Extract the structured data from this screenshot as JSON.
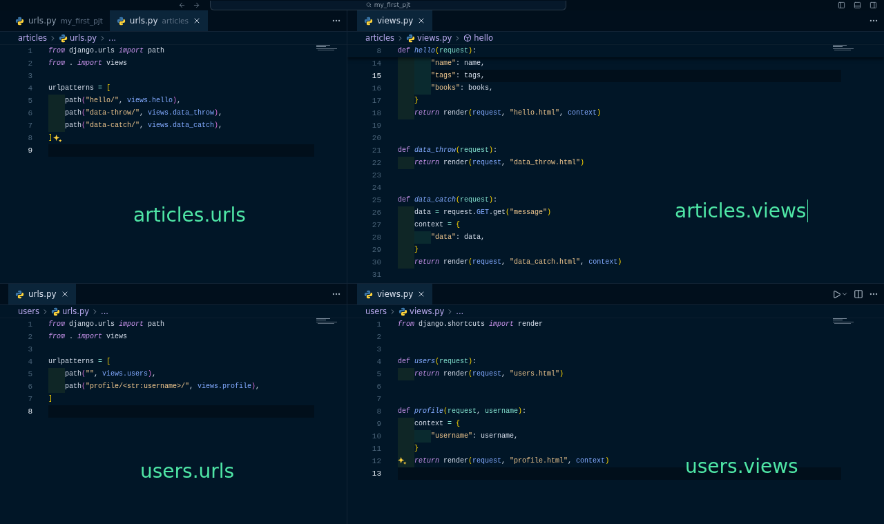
{
  "titlebar": {
    "search": "my_first_pjt"
  },
  "panes": [
    {
      "tabs": [
        {
          "label": "urls.py",
          "description": "my_first_pjt",
          "selected": false
        },
        {
          "label": "urls.py",
          "description": "articles",
          "selected": true
        }
      ],
      "actions": [
        {
          "kind": "more"
        }
      ],
      "breadcrumb": [
        {
          "kind": "folder",
          "text": "articles"
        },
        {
          "kind": "file",
          "text": "urls.py"
        },
        {
          "kind": "ellipsis",
          "text": "..."
        }
      ],
      "lines": [
        {
          "n": "1",
          "current": false,
          "tokens": [
            {
              "kind": "kw",
              "text": "from"
            },
            {
              "kind": "txt",
              "text": " django.urls "
            },
            {
              "kind": "kw",
              "text": "import"
            },
            {
              "kind": "txt",
              "text": " path"
            }
          ]
        },
        {
          "n": "2",
          "current": false,
          "tokens": [
            {
              "kind": "kw",
              "text": "from"
            },
            {
              "kind": "txt",
              "text": " . "
            },
            {
              "kind": "kw",
              "text": "import"
            },
            {
              "kind": "txt",
              "text": " views"
            }
          ]
        },
        {
          "n": "3",
          "current": false
        },
        {
          "n": "4",
          "current": false,
          "tokens": [
            {
              "kind": "txt",
              "text": "urlpatterns "
            },
            {
              "kind": "op",
              "text": "="
            },
            {
              "kind": "b1",
              "text": " ["
            }
          ]
        },
        {
          "n": "5",
          "current": false,
          "tokens": [
            {
              "kind": "indent"
            },
            {
              "kind": "txt",
              "text": "path"
            },
            {
              "kind": "b2",
              "text": "("
            },
            {
              "kind": "str",
              "text": "\"hello/\""
            },
            {
              "kind": "txt",
              "text": ", "
            },
            {
              "kind": "ref",
              "text": "views.hello"
            },
            {
              "kind": "b2",
              "text": ")"
            },
            {
              "kind": "txt",
              "text": ","
            }
          ]
        },
        {
          "n": "6",
          "current": false,
          "tokens": [
            {
              "kind": "indent"
            },
            {
              "kind": "txt",
              "text": "path"
            },
            {
              "kind": "b2",
              "text": "("
            },
            {
              "kind": "str",
              "text": "\"data-throw/\""
            },
            {
              "kind": "txt",
              "text": ", "
            },
            {
              "kind": "ref",
              "text": "views.data_throw"
            },
            {
              "kind": "b2",
              "text": ")"
            },
            {
              "kind": "txt",
              "text": ","
            }
          ]
        },
        {
          "n": "7",
          "current": false,
          "tokens": [
            {
              "kind": "indent"
            },
            {
              "kind": "txt",
              "text": "path"
            },
            {
              "kind": "b2",
              "text": "("
            },
            {
              "kind": "str",
              "text": "\"data-catch/\""
            },
            {
              "kind": "txt",
              "text": ", "
            },
            {
              "kind": "ref",
              "text": "views.data_catch"
            },
            {
              "kind": "b2",
              "text": ")"
            },
            {
              "kind": "txt",
              "text": ","
            }
          ]
        },
        {
          "n": "8",
          "current": false,
          "sparkle": true,
          "tokens": [
            {
              "kind": "b1",
              "text": "]"
            }
          ]
        },
        {
          "n": "9",
          "current": true
        }
      ],
      "annotation": {
        "text": "articles.urls",
        "cursor": false
      }
    },
    {
      "tabs": [
        {
          "label": "views.py",
          "selected": true
        }
      ],
      "actions": [
        {
          "kind": "more"
        }
      ],
      "breadcrumb": [
        {
          "kind": "folder",
          "text": "articles"
        },
        {
          "kind": "file",
          "text": "views.py"
        },
        {
          "kind": "symbol",
          "text": "hello"
        }
      ],
      "sticky": {
        "n": "8",
        "current": false,
        "tokens": [
          {
            "kind": "def",
            "text": "def "
          },
          {
            "kind": "fn",
            "text": "hello"
          },
          {
            "kind": "b1",
            "text": "("
          },
          {
            "kind": "param",
            "text": "request"
          },
          {
            "kind": "b1",
            "text": ")"
          },
          {
            "kind": "txt",
            "text": ":"
          }
        ]
      },
      "lines": [
        {
          "n": "14",
          "current": false,
          "tokens": [
            {
              "kind": "indent"
            },
            {
              "kind": "indent"
            },
            {
              "kind": "str",
              "text": "\"name\""
            },
            {
              "kind": "txt",
              "text": ": name,"
            }
          ]
        },
        {
          "n": "15",
          "current": true,
          "tokens": [
            {
              "kind": "indent"
            },
            {
              "kind": "indent"
            },
            {
              "kind": "str",
              "text": "\"tags\""
            },
            {
              "kind": "txt",
              "text": ": tags,"
            }
          ]
        },
        {
          "n": "16",
          "current": false,
          "tokens": [
            {
              "kind": "indent"
            },
            {
              "kind": "indent"
            },
            {
              "kind": "str",
              "text": "\"books\""
            },
            {
              "kind": "txt",
              "text": ": books,"
            }
          ]
        },
        {
          "n": "17",
          "current": false,
          "tokens": [
            {
              "kind": "indent"
            },
            {
              "kind": "b1",
              "text": "}"
            }
          ]
        },
        {
          "n": "18",
          "current": false,
          "tokens": [
            {
              "kind": "indent"
            },
            {
              "kind": "kw",
              "text": "return"
            },
            {
              "kind": "txt",
              "text": " render"
            },
            {
              "kind": "b1",
              "text": "("
            },
            {
              "kind": "ref",
              "text": "request"
            },
            {
              "kind": "txt",
              "text": ", "
            },
            {
              "kind": "str",
              "text": "\"hello.html\""
            },
            {
              "kind": "txt",
              "text": ", "
            },
            {
              "kind": "ref",
              "text": "context"
            },
            {
              "kind": "b1",
              "text": ")"
            }
          ]
        },
        {
          "n": "19",
          "current": false
        },
        {
          "n": "20",
          "current": false
        },
        {
          "n": "21",
          "current": false,
          "tokens": [
            {
              "kind": "def",
              "text": "def "
            },
            {
              "kind": "fn",
              "text": "data_throw"
            },
            {
              "kind": "b1",
              "text": "("
            },
            {
              "kind": "param",
              "text": "request"
            },
            {
              "kind": "b1",
              "text": ")"
            },
            {
              "kind": "txt",
              "text": ":"
            }
          ]
        },
        {
          "n": "22",
          "current": false,
          "tokens": [
            {
              "kind": "indent"
            },
            {
              "kind": "kw",
              "text": "return"
            },
            {
              "kind": "txt",
              "text": " render"
            },
            {
              "kind": "b1",
              "text": "("
            },
            {
              "kind": "ref",
              "text": "request"
            },
            {
              "kind": "txt",
              "text": ", "
            },
            {
              "kind": "str",
              "text": "\"data_throw.html\""
            },
            {
              "kind": "b1",
              "text": ")"
            }
          ]
        },
        {
          "n": "23",
          "current": false
        },
        {
          "n": "24",
          "current": false
        },
        {
          "n": "25",
          "current": false,
          "tokens": [
            {
              "kind": "def",
              "text": "def "
            },
            {
              "kind": "fn",
              "text": "data_catch"
            },
            {
              "kind": "b1",
              "text": "("
            },
            {
              "kind": "param",
              "text": "request"
            },
            {
              "kind": "b1",
              "text": ")"
            },
            {
              "kind": "txt",
              "text": ":"
            }
          ]
        },
        {
          "n": "26",
          "current": false,
          "tokens": [
            {
              "kind": "indent"
            },
            {
              "kind": "txt",
              "text": "data "
            },
            {
              "kind": "op",
              "text": "="
            },
            {
              "kind": "txt",
              "text": " request."
            },
            {
              "kind": "ref",
              "text": "GET"
            },
            {
              "kind": "txt",
              "text": ".get"
            },
            {
              "kind": "b1",
              "text": "("
            },
            {
              "kind": "str",
              "text": "\"message\""
            },
            {
              "kind": "b1",
              "text": ")"
            }
          ]
        },
        {
          "n": "27",
          "current": false,
          "tokens": [
            {
              "kind": "indent"
            },
            {
              "kind": "txt",
              "text": "context "
            },
            {
              "kind": "op",
              "text": "="
            },
            {
              "kind": "b1",
              "text": " {"
            }
          ]
        },
        {
          "n": "28",
          "current": false,
          "tokens": [
            {
              "kind": "indent"
            },
            {
              "kind": "indent"
            },
            {
              "kind": "str",
              "text": "\"data\""
            },
            {
              "kind": "txt",
              "text": ": data,"
            }
          ]
        },
        {
          "n": "29",
          "current": false,
          "tokens": [
            {
              "kind": "indent"
            },
            {
              "kind": "b1",
              "text": "}"
            }
          ]
        },
        {
          "n": "30",
          "current": false,
          "tokens": [
            {
              "kind": "indent"
            },
            {
              "kind": "kw",
              "text": "return"
            },
            {
              "kind": "txt",
              "text": " render"
            },
            {
              "kind": "b1",
              "text": "("
            },
            {
              "kind": "ref",
              "text": "request"
            },
            {
              "kind": "txt",
              "text": ", "
            },
            {
              "kind": "str",
              "text": "\"data_catch.html\""
            },
            {
              "kind": "txt",
              "text": ", "
            },
            {
              "kind": "ref",
              "text": "context"
            },
            {
              "kind": "b1",
              "text": ")"
            }
          ]
        },
        {
          "n": "31",
          "current": false
        }
      ],
      "annotation": {
        "text": "articles.views",
        "cursor": true
      }
    },
    {
      "tabs": [
        {
          "label": "urls.py",
          "selected": true
        }
      ],
      "actions": [
        {
          "kind": "more"
        }
      ],
      "breadcrumb": [
        {
          "kind": "folder",
          "text": "users"
        },
        {
          "kind": "file",
          "text": "urls.py"
        },
        {
          "kind": "ellipsis",
          "text": "..."
        }
      ],
      "lines": [
        {
          "n": "1",
          "current": false,
          "tokens": [
            {
              "kind": "kw",
              "text": "from"
            },
            {
              "kind": "txt",
              "text": " django.urls "
            },
            {
              "kind": "kw",
              "text": "import"
            },
            {
              "kind": "txt",
              "text": " path"
            }
          ]
        },
        {
          "n": "2",
          "current": false,
          "tokens": [
            {
              "kind": "kw",
              "text": "from"
            },
            {
              "kind": "txt",
              "text": " . "
            },
            {
              "kind": "kw",
              "text": "import"
            },
            {
              "kind": "txt",
              "text": " views"
            }
          ]
        },
        {
          "n": "3",
          "current": false
        },
        {
          "n": "4",
          "current": false,
          "tokens": [
            {
              "kind": "txt",
              "text": "urlpatterns "
            },
            {
              "kind": "op",
              "text": "="
            },
            {
              "kind": "b1",
              "text": " ["
            }
          ]
        },
        {
          "n": "5",
          "current": false,
          "tokens": [
            {
              "kind": "indent"
            },
            {
              "kind": "txt",
              "text": "path"
            },
            {
              "kind": "b2",
              "text": "("
            },
            {
              "kind": "str",
              "text": "\"\""
            },
            {
              "kind": "txt",
              "text": ", "
            },
            {
              "kind": "ref",
              "text": "views.users"
            },
            {
              "kind": "b2",
              "text": ")"
            },
            {
              "kind": "txt",
              "text": ","
            }
          ]
        },
        {
          "n": "6",
          "current": false,
          "tokens": [
            {
              "kind": "indent"
            },
            {
              "kind": "txt",
              "text": "path"
            },
            {
              "kind": "b2",
              "text": "("
            },
            {
              "kind": "str",
              "text": "\"profile/<str:username>/\""
            },
            {
              "kind": "txt",
              "text": ", "
            },
            {
              "kind": "ref",
              "text": "views.profile"
            },
            {
              "kind": "b2",
              "text": ")"
            },
            {
              "kind": "txt",
              "text": ","
            }
          ]
        },
        {
          "n": "7",
          "current": false,
          "tokens": [
            {
              "kind": "b1",
              "text": "]"
            }
          ]
        },
        {
          "n": "8",
          "current": true
        }
      ],
      "annotation": {
        "text": "users.urls",
        "cursor": false
      }
    },
    {
      "tabs": [
        {
          "label": "views.py",
          "selected": true
        }
      ],
      "actions": [
        {
          "kind": "run"
        },
        {
          "kind": "split"
        },
        {
          "kind": "more"
        }
      ],
      "breadcrumb": [
        {
          "kind": "folder",
          "text": "users"
        },
        {
          "kind": "file",
          "text": "views.py"
        },
        {
          "kind": "ellipsis",
          "text": "..."
        }
      ],
      "lines": [
        {
          "n": "1",
          "current": false,
          "tokens": [
            {
              "kind": "kw",
              "text": "from"
            },
            {
              "kind": "txt",
              "text": " django.shortcuts "
            },
            {
              "kind": "kw",
              "text": "import"
            },
            {
              "kind": "txt",
              "text": " render"
            }
          ]
        },
        {
          "n": "2",
          "current": false
        },
        {
          "n": "3",
          "current": false
        },
        {
          "n": "4",
          "current": false,
          "tokens": [
            {
              "kind": "def",
              "text": "def "
            },
            {
              "kind": "fn",
              "text": "users"
            },
            {
              "kind": "b1",
              "text": "("
            },
            {
              "kind": "param",
              "text": "request"
            },
            {
              "kind": "b1",
              "text": ")"
            },
            {
              "kind": "txt",
              "text": ":"
            }
          ]
        },
        {
          "n": "5",
          "current": false,
          "tokens": [
            {
              "kind": "indent"
            },
            {
              "kind": "kw",
              "text": "return"
            },
            {
              "kind": "txt",
              "text": " render"
            },
            {
              "kind": "b1",
              "text": "("
            },
            {
              "kind": "ref",
              "text": "request"
            },
            {
              "kind": "txt",
              "text": ", "
            },
            {
              "kind": "str",
              "text": "\"users.html\""
            },
            {
              "kind": "b1",
              "text": ")"
            }
          ]
        },
        {
          "n": "6",
          "current": false
        },
        {
          "n": "7",
          "current": false
        },
        {
          "n": "8",
          "current": false,
          "tokens": [
            {
              "kind": "def",
              "text": "def "
            },
            {
              "kind": "fn",
              "text": "profile"
            },
            {
              "kind": "b1",
              "text": "("
            },
            {
              "kind": "param",
              "text": "request"
            },
            {
              "kind": "txt",
              "text": ", "
            },
            {
              "kind": "param",
              "text": "username"
            },
            {
              "kind": "b1",
              "text": ")"
            },
            {
              "kind": "txt",
              "text": ":"
            }
          ]
        },
        {
          "n": "9",
          "current": false,
          "tokens": [
            {
              "kind": "indent"
            },
            {
              "kind": "txt",
              "text": "context "
            },
            {
              "kind": "op",
              "text": "="
            },
            {
              "kind": "b1",
              "text": " {"
            }
          ]
        },
        {
          "n": "10",
          "current": false,
          "tokens": [
            {
              "kind": "indent"
            },
            {
              "kind": "indent"
            },
            {
              "kind": "str",
              "text": "\"username\""
            },
            {
              "kind": "txt",
              "text": ": username,"
            }
          ]
        },
        {
          "n": "11",
          "current": false,
          "tokens": [
            {
              "kind": "indent"
            },
            {
              "kind": "b1",
              "text": "}"
            }
          ]
        },
        {
          "n": "12",
          "current": false,
          "sparkle": true,
          "tokens": [
            {
              "kind": "indent"
            },
            {
              "kind": "kw",
              "text": "return"
            },
            {
              "kind": "txt",
              "text": " render"
            },
            {
              "kind": "b1",
              "text": "("
            },
            {
              "kind": "ref",
              "text": "request"
            },
            {
              "kind": "txt",
              "text": ", "
            },
            {
              "kind": "str",
              "text": "\"profile.html\""
            },
            {
              "kind": "txt",
              "text": ", "
            },
            {
              "kind": "ref",
              "text": "context"
            },
            {
              "kind": "b1",
              "text": ")"
            }
          ]
        },
        {
          "n": "13",
          "current": true
        }
      ],
      "annotation": {
        "text": "users.views",
        "cursor": false
      }
    }
  ]
}
